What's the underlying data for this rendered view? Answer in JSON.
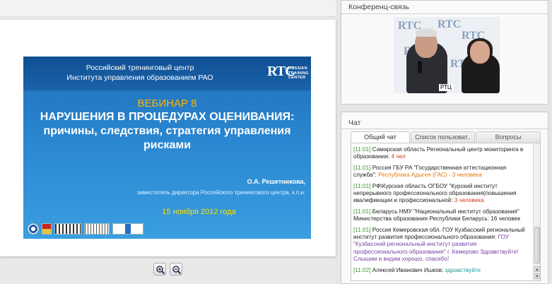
{
  "slide": {
    "org_line1": "Российский тренинговый центр",
    "org_line2": "Института управления образованием РАО",
    "logo_mark": "RTC",
    "logo_line1": "RUSSIAN",
    "logo_line2": "TRAINING",
    "logo_line3": "CENTER",
    "webinar": "ВЕБИНАР 8",
    "title_line1": "НАРУШЕНИЯ В ПРОЦЕДУРАХ ОЦЕНИВАНИЯ:",
    "title_line2": "причины, следствия, стратегия управления",
    "title_line3": "рисками",
    "author": "О.А. Решетникова,",
    "position": "заместитель директора Российского тренингового центра, к.п.н.",
    "date": "15 ноября 2012 года"
  },
  "conference": {
    "title": "Конференц-связь",
    "video_label": "РТЦ",
    "backdrop_mark": "RTC"
  },
  "chat": {
    "title": "Чат",
    "tabs": [
      "Общий чат",
      "Список пользоват..",
      "Вопросы"
    ],
    "messages": [
      {
        "time": "[11:01]",
        "text": "Самарская область Региональный центр мониторинга в образовании: ",
        "highlight": "4 чел",
        "hl_color": "red"
      },
      {
        "time": "[11:01]",
        "text": "Россия ГБУ РА \"Государственная аттестационная служба\": ",
        "highlight": "Республика Адыгея (ГАС) - 3 человека",
        "hl_color": "orange"
      },
      {
        "time": "[11:01]",
        "text": "РФ\\Курская область ОГБОУ \"Курский институт непрерывного профессионального образования(повышения квалификации и профессиональной: ",
        "highlight": "3 человека",
        "hl_color": "red"
      },
      {
        "time": "[11:01]",
        "text": "Беларусь НМУ \"Национальный институт образования\" Министерства образования Республики Беларусь: 16 человек",
        "highlight": "",
        "hl_color": ""
      },
      {
        "time": "[11:01]",
        "text": "Россия Кемеровская обл. ГОУ Кузбасский региональный институт развития профессионального образования: ",
        "highlight": "ГОУ \"Кузбасский региональный институт развития профессионального образования\" г. Кемерово Здравствуйте! Слышим и видим хорошо, спасибо!",
        "hl_color": "purple"
      },
      {
        "time": "[11:02]",
        "text": "Алексей Иванович Ишков: ",
        "highlight": "здравствуйте",
        "hl_color": "teal"
      }
    ]
  },
  "icons": {
    "zoom_in": "zoom-in-icon",
    "zoom_out": "zoom-out-icon"
  }
}
